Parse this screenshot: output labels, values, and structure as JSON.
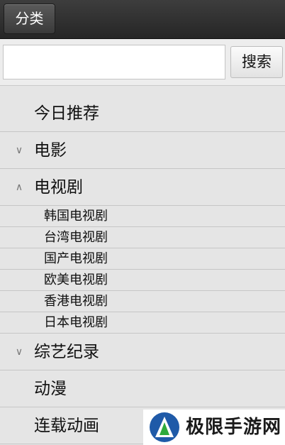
{
  "header": {
    "category_label": "分类"
  },
  "search": {
    "value": "",
    "placeholder": "",
    "button_label": "搜索"
  },
  "menu": {
    "item_0": {
      "label": "今日推荐",
      "chevron": ""
    },
    "item_1": {
      "label": "电影",
      "chevron": "chevron-down-icon"
    },
    "item_2": {
      "label": "电视剧",
      "chevron": "chevron-up-icon",
      "expanded": true,
      "sub": [
        "韩国电视剧",
        "台湾电视剧",
        "国产电视剧",
        "欧美电视剧",
        "香港电视剧",
        "日本电视剧"
      ]
    },
    "item_3": {
      "label": "综艺纪录",
      "chevron": "chevron-down-icon"
    },
    "item_4": {
      "label": "动漫",
      "chevron": ""
    },
    "item_5": {
      "label": "连载动画",
      "chevron": ""
    }
  },
  "watermark": {
    "text": "极限手游网"
  },
  "colors": {
    "topbar": "#2e2e2e",
    "list_background": "#e5e5e5",
    "divider": "#c6c6c6",
    "logo_blue": "#1f5aa8",
    "logo_green": "#2eaa3c"
  }
}
